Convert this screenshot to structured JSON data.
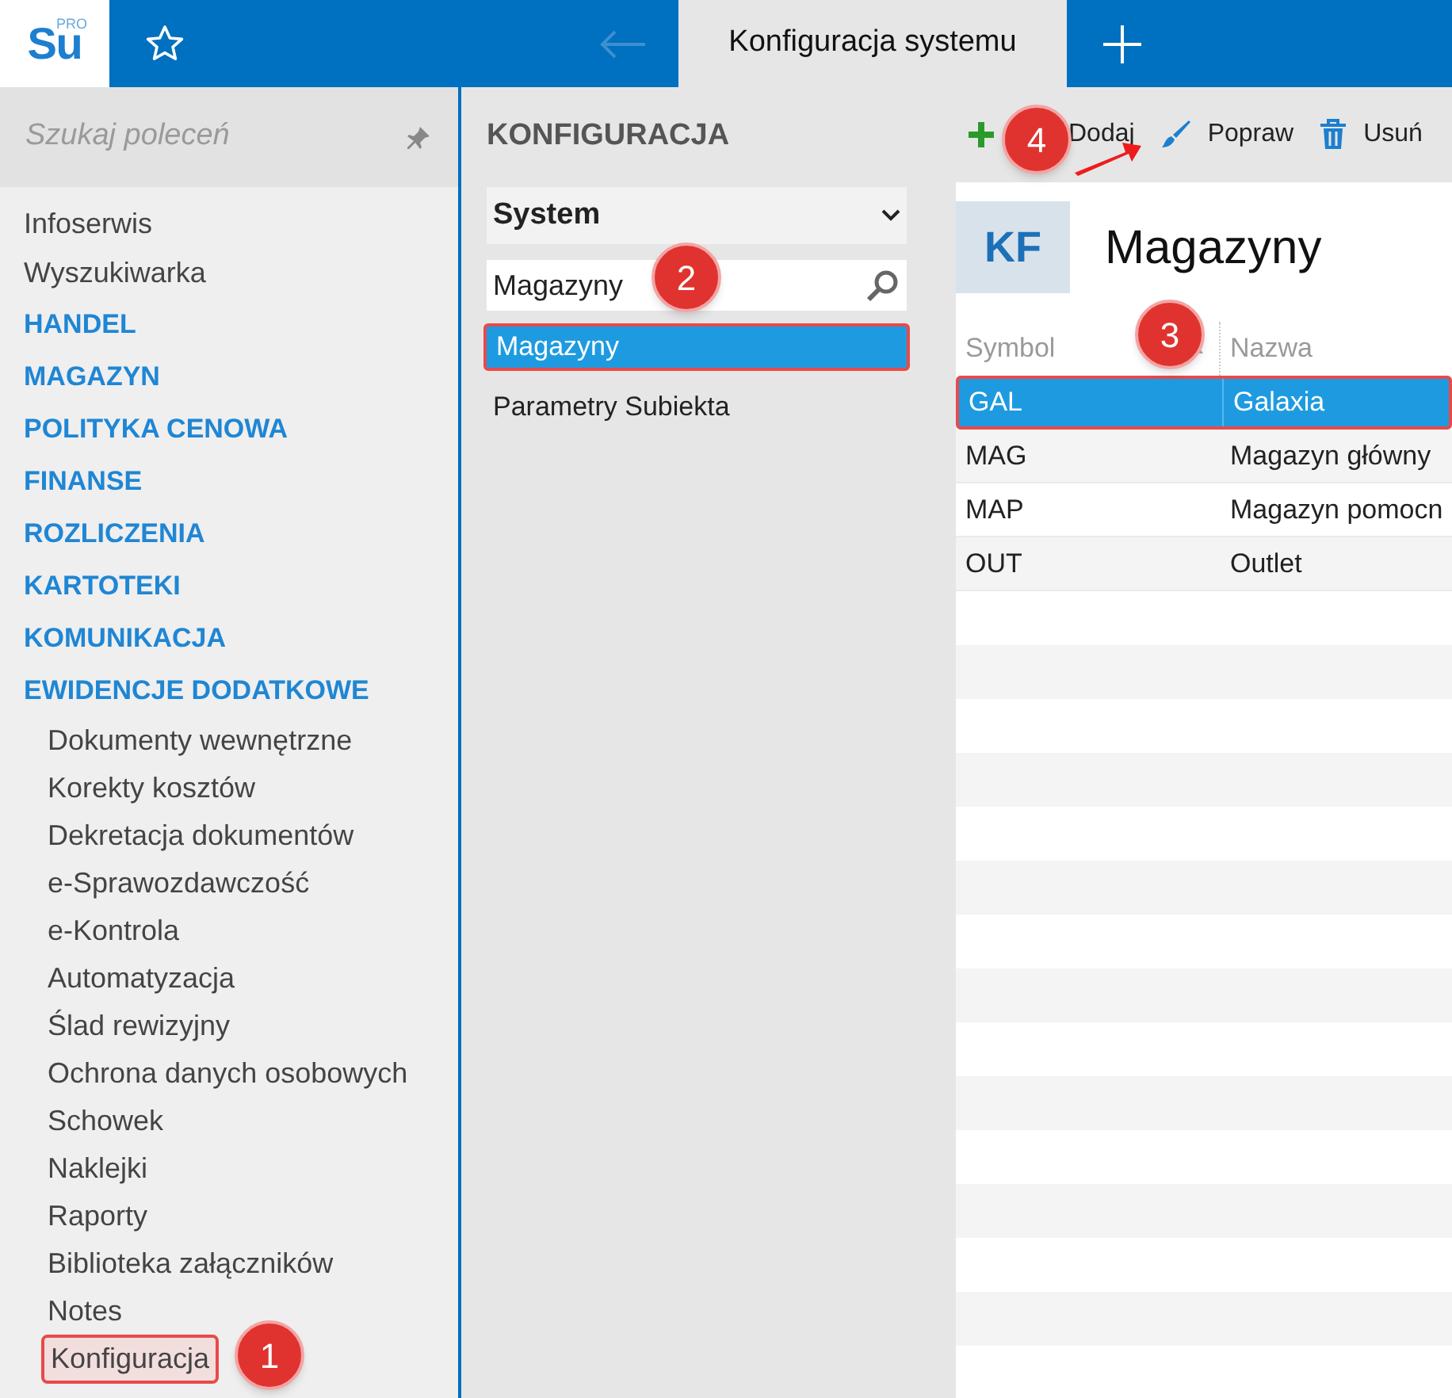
{
  "app_logo": {
    "text": "Su",
    "edition": "PRO"
  },
  "tabs": [
    {
      "label": "Konfiguracja systemu",
      "selected": true
    }
  ],
  "back_disabled": true,
  "sidebar": {
    "search_placeholder": "Szukaj poleceń",
    "items": [
      {
        "label": "Infoserwis",
        "kind": "link",
        "annotated": false
      },
      {
        "label": "Wyszukiwarka",
        "kind": "link",
        "annotated": false
      },
      {
        "label": "HANDEL",
        "kind": "section",
        "annotated": false
      },
      {
        "label": "MAGAZYN",
        "kind": "section",
        "annotated": false
      },
      {
        "label": "POLITYKA CENOWA",
        "kind": "section",
        "annotated": false
      },
      {
        "label": "FINANSE",
        "kind": "section",
        "annotated": false
      },
      {
        "label": "ROZLICZENIA",
        "kind": "section",
        "annotated": false
      },
      {
        "label": "KARTOTEKI",
        "kind": "section",
        "annotated": false
      },
      {
        "label": "KOMUNIKACJA",
        "kind": "section",
        "annotated": false
      },
      {
        "label": "EWIDENCJE DODATKOWE",
        "kind": "section",
        "annotated": false
      },
      {
        "label": "Dokumenty wewnętrzne",
        "kind": "sub",
        "annotated": false
      },
      {
        "label": "Korekty kosztów",
        "kind": "sub",
        "annotated": false
      },
      {
        "label": "Dekretacja dokumentów",
        "kind": "sub",
        "annotated": false
      },
      {
        "label": "e-Sprawozdawczość",
        "kind": "sub",
        "annotated": false
      },
      {
        "label": "e-Kontrola",
        "kind": "sub",
        "annotated": false
      },
      {
        "label": "Automatyzacja",
        "kind": "sub",
        "annotated": false
      },
      {
        "label": "Ślad rewizyjny",
        "kind": "sub",
        "annotated": false
      },
      {
        "label": "Ochrona danych osobowych",
        "kind": "sub",
        "annotated": false
      },
      {
        "label": "Schowek",
        "kind": "sub",
        "annotated": false
      },
      {
        "label": "Naklejki",
        "kind": "sub",
        "annotated": false
      },
      {
        "label": "Raporty",
        "kind": "sub",
        "annotated": false
      },
      {
        "label": "Biblioteka załączników",
        "kind": "sub",
        "annotated": false
      },
      {
        "label": "Notes",
        "kind": "sub",
        "annotated": false
      },
      {
        "label": "Konfiguracja",
        "kind": "sub",
        "annotated": true
      }
    ]
  },
  "config_panel": {
    "title": "KONFIGURACJA",
    "group": "System",
    "search_value": "Magazyny",
    "items": [
      {
        "label": "Magazyny",
        "selected": true,
        "annotated": true
      },
      {
        "label": "Parametry Subiekta",
        "selected": false,
        "annotated": false
      }
    ]
  },
  "toolbar": [
    {
      "label": "Dodaj",
      "kind": "add"
    },
    {
      "label": "Popraw",
      "kind": "edit"
    },
    {
      "label": "Usuń",
      "kind": "delete"
    }
  ],
  "header": {
    "badge": "KF",
    "title": "Magazyny"
  },
  "table": {
    "columns": [
      {
        "label": "Symbol",
        "sorted": true
      },
      {
        "label": "Nazwa",
        "sorted": false
      }
    ],
    "rows": [
      {
        "cells": [
          "GAL",
          "Galaxia"
        ],
        "selected": true,
        "annotated": true
      },
      {
        "cells": [
          "MAG",
          "Magazyn główny"
        ],
        "selected": false,
        "annotated": false
      },
      {
        "cells": [
          "MAP",
          "Magazyn pomocn"
        ],
        "selected": false,
        "annotated": false
      },
      {
        "cells": [
          "OUT",
          "Outlet"
        ],
        "selected": false,
        "annotated": false
      }
    ]
  },
  "callouts": [
    {
      "label": "1"
    },
    {
      "label": "2"
    },
    {
      "label": "3"
    },
    {
      "label": "4"
    }
  ]
}
